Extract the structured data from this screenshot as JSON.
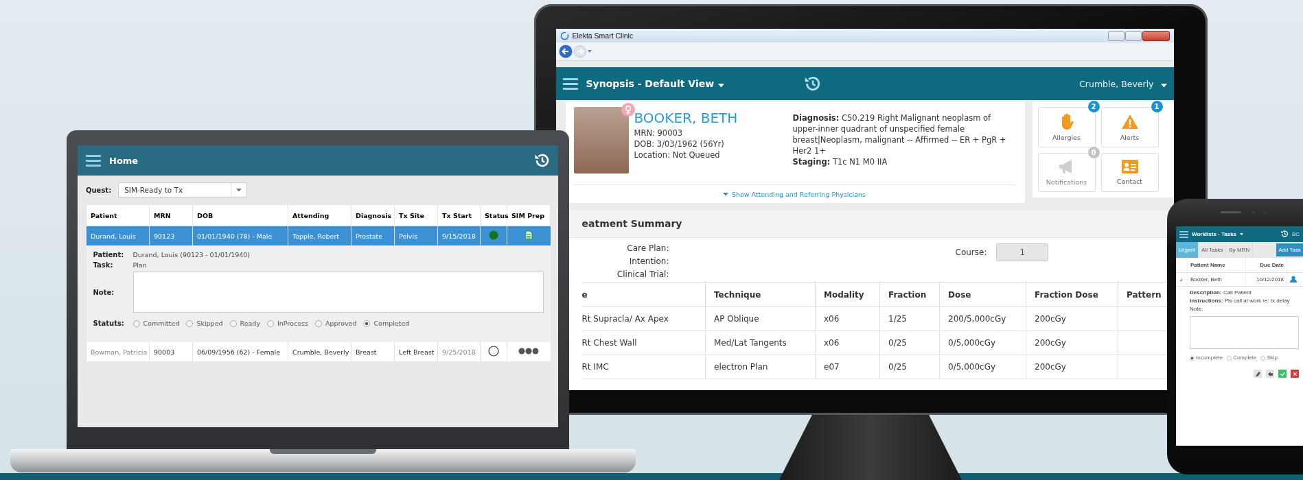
{
  "laptop": {
    "header": {
      "title": "Home"
    },
    "quest": {
      "label": "Quest:",
      "value": "SIM-Ready to Tx"
    },
    "table": {
      "columns": [
        "Patient",
        "MRN",
        "DOB",
        "Attending",
        "Diagnosis",
        "Tx Site",
        "Tx Start",
        "Status",
        "SIM Prep"
      ],
      "rows": [
        {
          "cells": [
            "Durand, Louis",
            "90123",
            "01/01/1940 (78) - Male",
            "Topple, Robert",
            "Prostate",
            "Pelvis",
            "9/15/2018"
          ],
          "status_icon": {
            "kind": "filled"
          },
          "prep_icon": {
            "kind": "document"
          },
          "selected": true,
          "expanded": true,
          "detail": {
            "fields": [
              {
                "label": "Patient:",
                "value": "Durand, Louis (90123 - 01/01/1940)"
              },
              {
                "label": "Task:",
                "value": "Plan"
              }
            ],
            "note_label": "Note:",
            "status_label": "Statuts:",
            "statuses": [
              {
                "label": "Committed",
                "selected": false
              },
              {
                "label": "Skipped",
                "selected": false
              },
              {
                "label": "Ready",
                "selected": false
              },
              {
                "label": "InProcess",
                "selected": false
              },
              {
                "label": "Approved",
                "selected": false
              },
              {
                "label": "Completed",
                "selected": true
              }
            ]
          }
        },
        {
          "cells": [
            "Bowman, Patricia",
            "90003",
            "06/09/1956 (62) - Female",
            "Crumble, Beverly",
            "Breast",
            "Left Breast",
            "9/25/2018"
          ],
          "status_icon": {
            "kind": "empty"
          },
          "prep_icon": {
            "kind": "dots"
          },
          "selected": false,
          "expanded": false
        }
      ]
    }
  },
  "monitor": {
    "window": {
      "title": "Elekta Smart Clinic"
    },
    "header": {
      "title": "Synopsis - Default View",
      "user": "Crumble, Beverly"
    },
    "patient": {
      "name": "BOOKER, BETH",
      "details": [
        "MRN: 90003",
        "DOB: 3/03/1962 (56Yr)",
        "Location: Not Queued"
      ],
      "diagnosis": "**Diagnosis:** C50.219 Right Malignant neoplasm of upper-inner quadrant of unspecified female breast|Neoplasm, malignant -- Affirmed -- ER + PgR + Her2 1+",
      "staging": "**Staging:** T1c N1 M0 IIA",
      "link": "Show Attending and Referring Physicians"
    },
    "tiles": [
      {
        "kind": "allergies",
        "label": "Allergies",
        "badge": "2",
        "disabled": false
      },
      {
        "kind": "alerts",
        "label": "Alerts",
        "badge": "1",
        "disabled": false
      },
      {
        "kind": "notifications",
        "label": "Notifications",
        "badge": "0",
        "disabled": true
      },
      {
        "kind": "contact",
        "label": "Contact",
        "disabled": false
      }
    ],
    "treatment_summary": {
      "title": "eatment Summary",
      "fields": [
        "Care Plan:",
        "Intention:",
        "Clinical Trial:"
      ],
      "course": {
        "label": "Course:",
        "value": "1"
      },
      "table": {
        "columns": [
          "e",
          "Technique",
          "Modality",
          "Fraction",
          "Dose",
          "Fraction Dose",
          "Pattern"
        ],
        "rows": [
          [
            "Rt Supracla/ Ax Apex",
            "AP Oblique",
            "x06",
            "1/25",
            "200/5,000cGy",
            "200cGy"
          ],
          [
            "Rt Chest Wall",
            "Med/Lat Tangents",
            "x06",
            "0/25",
            "0/5,000cGy",
            "200cGy"
          ],
          [
            "Rt IMC",
            "electron Plan",
            "e07",
            "0/25",
            "0/5,000cGy",
            "200cGy"
          ]
        ]
      }
    }
  },
  "phone": {
    "header": {
      "title": "Worklists - Tasks",
      "user": "BC"
    },
    "tabs": [
      {
        "label": "Urgent",
        "selected": true
      },
      {
        "label": "All Tasks",
        "selected": false
      },
      {
        "label": "By MRN",
        "selected": false
      }
    ],
    "add_button": "Add Task",
    "table": {
      "columns": [
        "Patient Name",
        "Due Date"
      ],
      "rows": [
        {
          "cells": [
            "Booker, Beth",
            "10/12/2018"
          ]
        }
      ]
    },
    "task": {
      "description": "**Description:** Call Patient",
      "instructions": "**Instructions:** Pls call at work re: tx delay",
      "note_label": "Note:",
      "statuses": [
        {
          "label": "Incomplete",
          "selected": true
        },
        {
          "label": "Complete",
          "selected": false
        },
        {
          "label": "Skip",
          "selected": false
        }
      ]
    }
  }
}
